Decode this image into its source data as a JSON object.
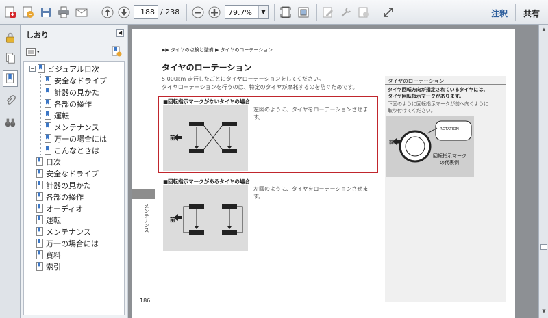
{
  "toolbar": {
    "page_current": "188",
    "page_total": "/ 238",
    "zoom": "79.7%",
    "comment_label": "注釈",
    "share_label": "共有"
  },
  "panel": {
    "title": "しおり",
    "items": [
      {
        "label": "ビジュアル目次"
      },
      {
        "label": "安全なドライブ"
      },
      {
        "label": "計器の見かた"
      },
      {
        "label": "各部の操作"
      },
      {
        "label": "運転"
      },
      {
        "label": "メンテナンス"
      },
      {
        "label": "万一の場合には"
      },
      {
        "label": "こんなときは"
      },
      {
        "label": "目次"
      },
      {
        "label": "安全なドライブ"
      },
      {
        "label": "計器の見かた"
      },
      {
        "label": "各部の操作"
      },
      {
        "label": "オーディオ"
      },
      {
        "label": "運転"
      },
      {
        "label": "メンテナンス"
      },
      {
        "label": "万一の場合には"
      },
      {
        "label": "資料"
      },
      {
        "label": "索引"
      }
    ]
  },
  "doc": {
    "breadcrumb": "▶▶ タイヤの点検と整備 ▶ タイヤのローテーション",
    "heading": "タイヤのローテーション",
    "intro_1": "5,000km 走行したごとにタイヤローテーションをしてください。",
    "intro_2": "タイヤローテーションを行うのは、特定のタイヤが摩耗するのを防ぐためです。",
    "sec1_title": "■回転指示マークがないタイヤの場合",
    "sec1_text": "左図のように、タイヤをローテーションさせます。",
    "sec2_title": "■回転指示マークがあるタイヤの場合",
    "sec2_text": "左図のように、タイヤをローテーションさせます。",
    "front_label": "前",
    "side_title": "タイヤのローテーション",
    "side_bold_1": "タイヤ回転方向が指定されているタイヤには、",
    "side_bold_2": "タイヤ回転指示マークがあります。",
    "side_text_1": "下図のように回転指示マークが前へ向くように",
    "side_text_2": "取り付けてください。",
    "side_front": "前部",
    "side_rotation": "ROTATION",
    "side_caption_1": "回転指示マーク",
    "side_caption_2": "の代表例",
    "chapter_label": "メンテナンス",
    "page_number": "186"
  },
  "colors": {
    "highlight": "#c0262d",
    "link_blue": "#2d5e9c"
  }
}
